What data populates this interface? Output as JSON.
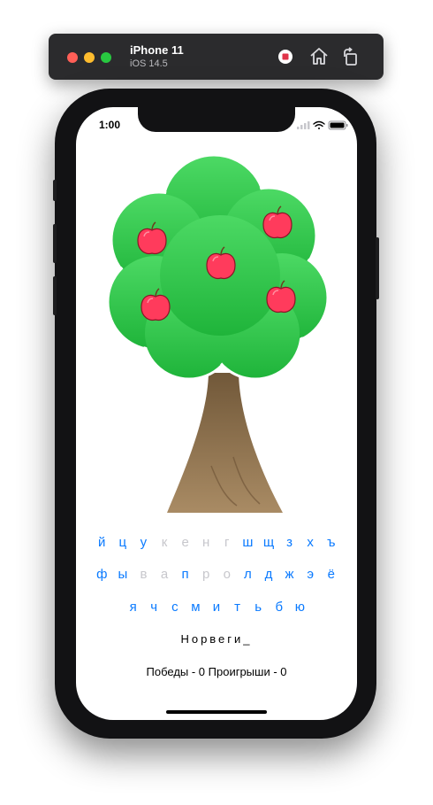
{
  "simulator": {
    "device_name": "iPhone 11",
    "os_version": "iOS 14.5",
    "buttons": [
      "stop-icon",
      "home-icon",
      "rotate-icon"
    ]
  },
  "status_bar": {
    "time": "1:00"
  },
  "tree": {
    "apples_count": 5,
    "leaf_color": "#22b943",
    "trunk_color": "#8f7152",
    "apple_color": "#ff3b5c"
  },
  "keyboard": {
    "row1": [
      {
        "letter": "й",
        "used": false
      },
      {
        "letter": "ц",
        "used": false
      },
      {
        "letter": "у",
        "used": false
      },
      {
        "letter": "к",
        "used": true
      },
      {
        "letter": "е",
        "used": true
      },
      {
        "letter": "н",
        "used": true
      },
      {
        "letter": "г",
        "used": true
      },
      {
        "letter": "ш",
        "used": false
      },
      {
        "letter": "щ",
        "used": false
      },
      {
        "letter": "з",
        "used": false
      },
      {
        "letter": "х",
        "used": false
      },
      {
        "letter": "ъ",
        "used": false
      }
    ],
    "row2": [
      {
        "letter": "ф",
        "used": false
      },
      {
        "letter": "ы",
        "used": false
      },
      {
        "letter": "в",
        "used": true
      },
      {
        "letter": "а",
        "used": true
      },
      {
        "letter": "п",
        "used": false
      },
      {
        "letter": "р",
        "used": true
      },
      {
        "letter": "о",
        "used": true
      },
      {
        "letter": "л",
        "used": false
      },
      {
        "letter": "д",
        "used": false
      },
      {
        "letter": "ж",
        "used": false
      },
      {
        "letter": "э",
        "used": false
      },
      {
        "letter": "ё",
        "used": false
      }
    ],
    "row3": [
      {
        "letter": "я",
        "used": false
      },
      {
        "letter": "ч",
        "used": false
      },
      {
        "letter": "с",
        "used": false
      },
      {
        "letter": "м",
        "used": false
      },
      {
        "letter": "и",
        "used": false
      },
      {
        "letter": "т",
        "used": false
      },
      {
        "letter": "ь",
        "used": false
      },
      {
        "letter": "б",
        "used": false
      },
      {
        "letter": "ю",
        "used": false
      }
    ]
  },
  "game": {
    "word_display": "Норвеги_",
    "score_text": "Победы - 0  Проигрыши - 0"
  },
  "colors": {
    "accent": "#0a7aff",
    "used_letter": "#c7c7cc"
  }
}
